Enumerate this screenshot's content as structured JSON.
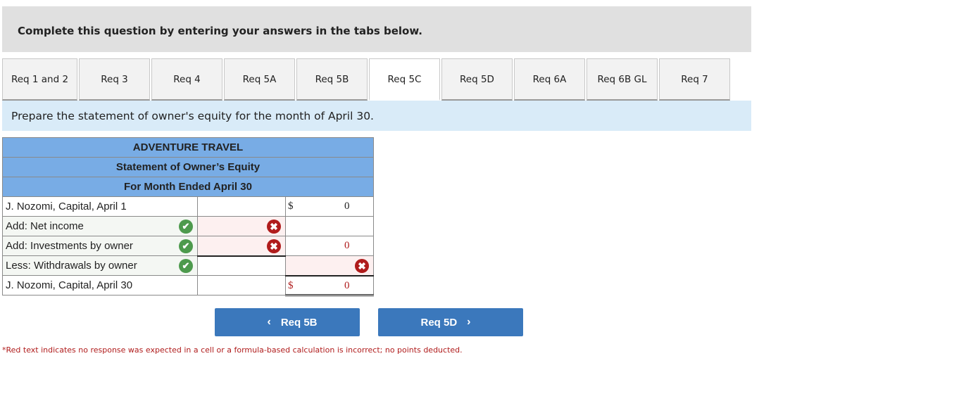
{
  "instruction": "Complete this question by entering your answers in the tabs below.",
  "tabs": [
    {
      "label": "Req 1 and 2",
      "active": false
    },
    {
      "label": "Req 3",
      "active": false
    },
    {
      "label": "Req 4",
      "active": false
    },
    {
      "label": "Req 5A",
      "active": false
    },
    {
      "label": "Req 5B",
      "active": false
    },
    {
      "label": "Req 5C",
      "active": true
    },
    {
      "label": "Req 5D",
      "active": false
    },
    {
      "label": "Req 6A",
      "active": false
    },
    {
      "label": "Req 6B GL",
      "active": false
    },
    {
      "label": "Req 7",
      "active": false
    }
  ],
  "prompt": "Prepare the statement of owner's equity for the month of April 30.",
  "statement": {
    "company": "ADVENTURE TRAVEL",
    "title": "Statement of Owner’s Equity",
    "period": "For Month Ended April 30",
    "rows": [
      {
        "label": "J. Nozomi, Capital, April 1",
        "label_status": "",
        "mid": "",
        "mid_status": "",
        "right_dollar": "$",
        "right": "0",
        "right_status": ""
      },
      {
        "label": "Add: Net income",
        "label_status": "correct",
        "mid": "",
        "mid_status": "incorrect",
        "right_dollar": "",
        "right": "",
        "right_status": ""
      },
      {
        "label": "Add: Investments by owner",
        "label_status": "correct",
        "mid": "",
        "mid_status": "incorrect",
        "right_dollar": "",
        "right": "0",
        "right_status": "calc"
      },
      {
        "label": "Less: Withdrawals by owner",
        "label_status": "correct",
        "mid": "",
        "mid_status": "",
        "right_dollar": "",
        "right": "",
        "right_status": "incorrect"
      },
      {
        "label": "J. Nozomi, Capital, April 30",
        "label_status": "",
        "mid": "",
        "mid_status": "",
        "right_dollar": "$",
        "right": "0",
        "right_status": "calc"
      }
    ]
  },
  "nav": {
    "prev_label": "Req 5B",
    "next_label": "Req 5D",
    "prev_icon": "‹",
    "next_icon": "›"
  },
  "icons": {
    "check": "✔",
    "cross": "✖"
  },
  "footnote": "*Red text indicates no response was expected in a cell or a formula-based calculation is incorrect; no points deducted."
}
